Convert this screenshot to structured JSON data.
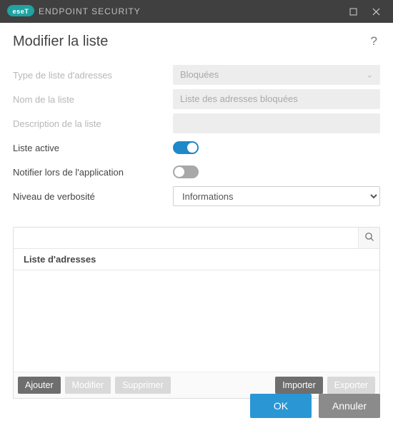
{
  "titlebar": {
    "app_name": "ENDPOINT SECURITY"
  },
  "header": {
    "title": "Modifier la liste"
  },
  "form": {
    "type_label": "Type de liste d'adresses",
    "type_value": "Bloquées",
    "name_label": "Nom de la liste",
    "name_value": "Liste des adresses bloquées",
    "desc_label": "Description de la liste",
    "desc_value": "",
    "active_label": "Liste active",
    "notify_label": "Notifier lors de l'application",
    "verbosity_label": "Niveau de verbosité",
    "verbosity_value": "Informations"
  },
  "list": {
    "header": "Liste d'adresses",
    "search_placeholder": ""
  },
  "actions": {
    "add": "Ajouter",
    "edit": "Modifier",
    "delete": "Supprimer",
    "import": "Importer",
    "export": "Exporter"
  },
  "footer": {
    "ok": "OK",
    "cancel": "Annuler"
  }
}
